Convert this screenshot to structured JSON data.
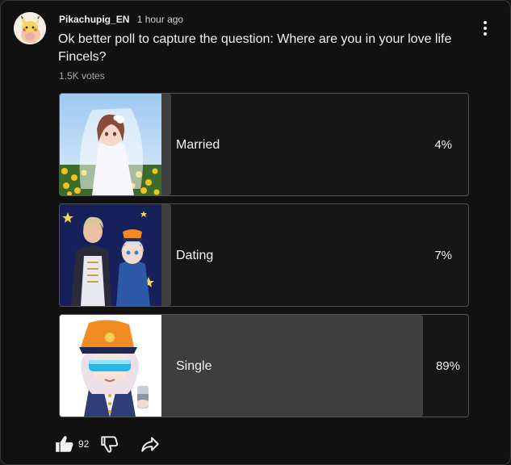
{
  "post": {
    "author": "Pikachupig_EN",
    "timestamp": "1 hour ago",
    "text": "Ok better poll to capture the question: Where are you in your love life Fincels?",
    "votes": "1.5K votes"
  },
  "poll": {
    "options": [
      {
        "label": "Married",
        "percent_text": "4%",
        "fill_fraction": 0.04,
        "image": "anime-bride-in-sunflower-field"
      },
      {
        "label": "Dating",
        "percent_text": "7%",
        "fill_fraction": 0.07,
        "image": "anime-couple-in-uniforms"
      },
      {
        "label": "Single",
        "percent_text": "89%",
        "fill_fraction": 0.89,
        "image": "anime-character-with-visor-and-can"
      }
    ]
  },
  "actions": {
    "like_count": "92"
  },
  "icons": {
    "menu": "more-vertical-icon",
    "like": "thumbs-up-icon",
    "dislike": "thumbs-down-icon",
    "share": "share-arrow-icon"
  },
  "colors": {
    "background": "#111111",
    "poll_fill": "#3e3e3e",
    "poll_border": "#555555",
    "text": "#f1f1f1",
    "muted_text": "#aaaaaa"
  }
}
